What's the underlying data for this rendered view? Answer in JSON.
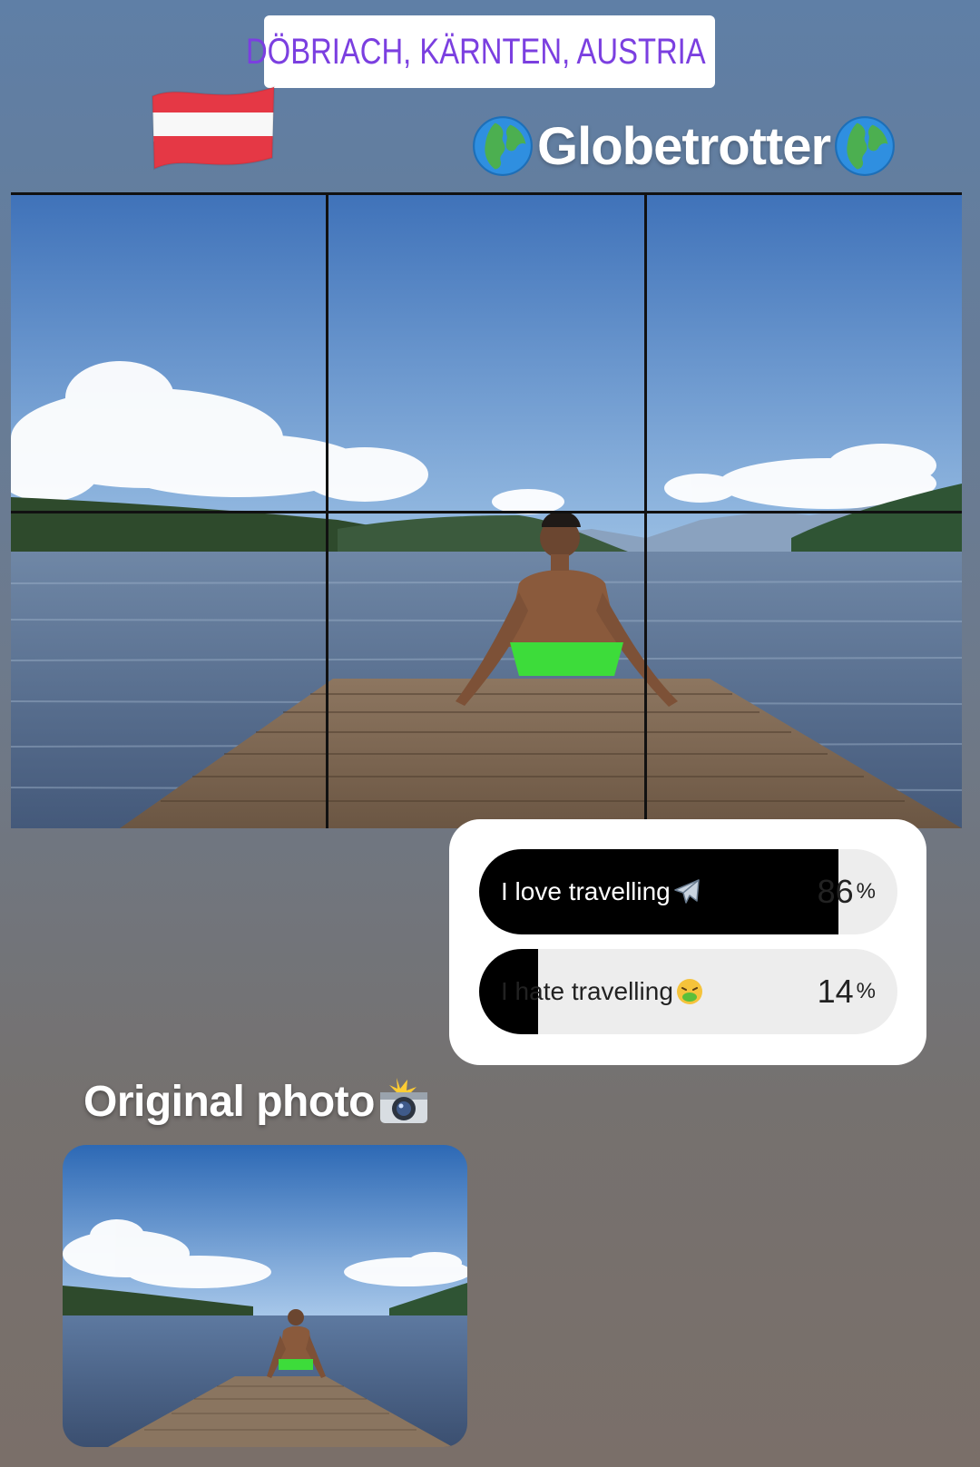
{
  "location": {
    "label": "DÖBRIACH, KÄRNTEN, AUSTRIA"
  },
  "flag": {
    "icon": "austria-flag"
  },
  "title": {
    "text": "Globetrotter",
    "icon": "globe-europe-africa"
  },
  "poll": {
    "options": [
      {
        "label": "I love travelling",
        "emoji": "airplane",
        "percent": "86",
        "unit": "%",
        "fraction": 0.86
      },
      {
        "label": "I hate travelling",
        "emoji": "nauseated-face",
        "percent": "14",
        "unit": "%",
        "fraction": 0.14
      }
    ]
  },
  "caption": {
    "text": "Original photo",
    "icon": "camera-with-flash"
  },
  "colors": {
    "location_text": "#7b3fe0",
    "poll_fill": "#000000",
    "poll_track": "#ededed"
  }
}
